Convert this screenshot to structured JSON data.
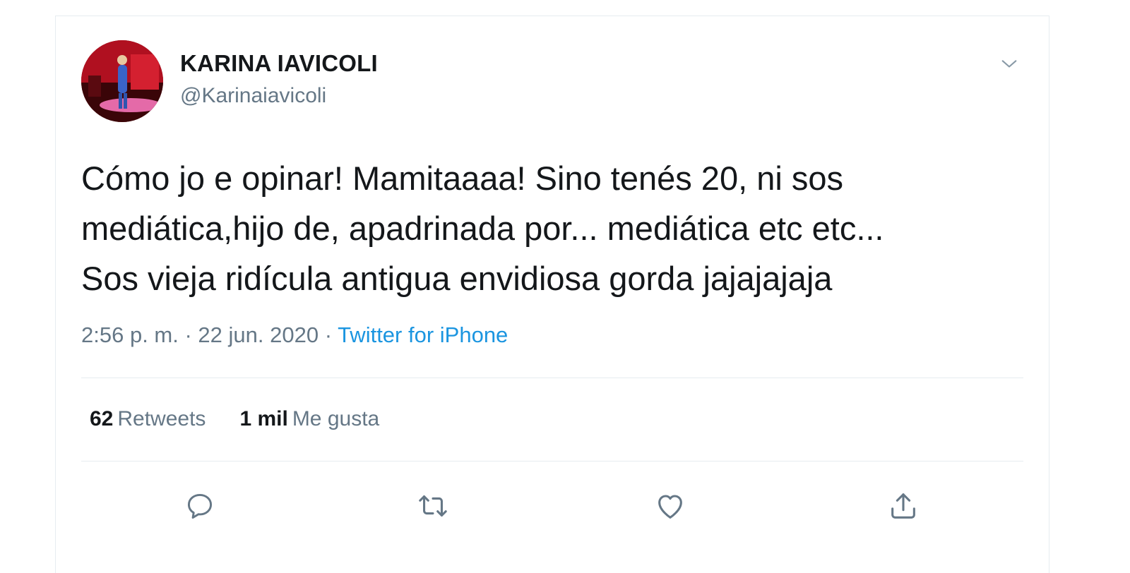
{
  "author": {
    "display_name": "KARINA IAVICOLI",
    "handle": "@Karinaiavicoli"
  },
  "tweet": {
    "lines": [
      "Cómo jo   e opinar! Mamitaaaa! Sino tenés 20, ni sos",
      "mediática,hijo de, apadrinada por... mediática etc etc...",
      "Sos vieja ridícula antigua envidiosa gorda jajajajaja"
    ],
    "time": "2:56 p. m.",
    "separator": " · ",
    "date": "22 jun. 2020",
    "source": "Twitter for iPhone"
  },
  "stats": {
    "retweets_count": "62",
    "retweets_label": "Retweets",
    "likes_count": "1 mil",
    "likes_label": "Me gusta"
  },
  "icons": {
    "reply": "reply-icon",
    "retweet": "retweet-icon",
    "like": "heart-icon",
    "share": "share-icon",
    "caret": "chevron-down-icon"
  },
  "colors": {
    "text": "#14171a",
    "secondary": "#657786",
    "link": "#1b95e0",
    "divider": "#e6ecf0"
  }
}
